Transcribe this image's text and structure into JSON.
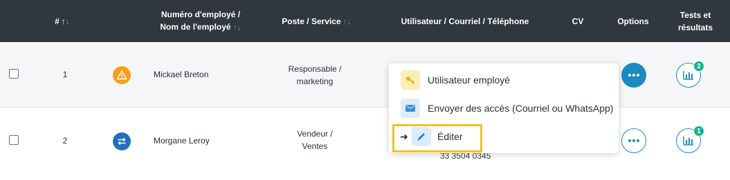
{
  "header": {
    "col_num": "#",
    "col_employee_line1": "Numéro d'employé /",
    "col_employee_line2": "Nom de l'employé",
    "col_poste": "Poste / Service",
    "col_contact": "Utilisateur / Courriel / Téléphone",
    "col_cv": "CV",
    "col_options": "Options",
    "col_tests_line1": "Tests et",
    "col_tests_line2": "résultats"
  },
  "rows": [
    {
      "number": "1",
      "status_icon": "warning-icon",
      "status_color": "#f6a01a",
      "name": "Mickael Breton",
      "poste_line1": "Responsable /",
      "poste_line2": "marketing",
      "contact_partial": "...",
      "tests_badge": "2"
    },
    {
      "number": "2",
      "status_icon": "swap-arrows-icon",
      "status_color": "#1f6fc0",
      "name": "Morgane Leroy",
      "poste_line1": "Vendeur /",
      "poste_line2": "Ventes",
      "contact_partial": "33 3504 0345",
      "tests_badge": "1"
    }
  ],
  "menu": {
    "items": [
      {
        "label": "Utilisateur employé",
        "icon": "key-icon"
      },
      {
        "label": "Envoyer des accès (Courriel ou WhatsApp)",
        "icon": "email-icon"
      },
      {
        "label": "Éditer",
        "icon": "pencil-icon"
      }
    ]
  },
  "colors": {
    "header_bg": "#31373e",
    "accent": "#1a8bc0",
    "badge": "#15b48f",
    "highlight": "#f2c21a"
  }
}
